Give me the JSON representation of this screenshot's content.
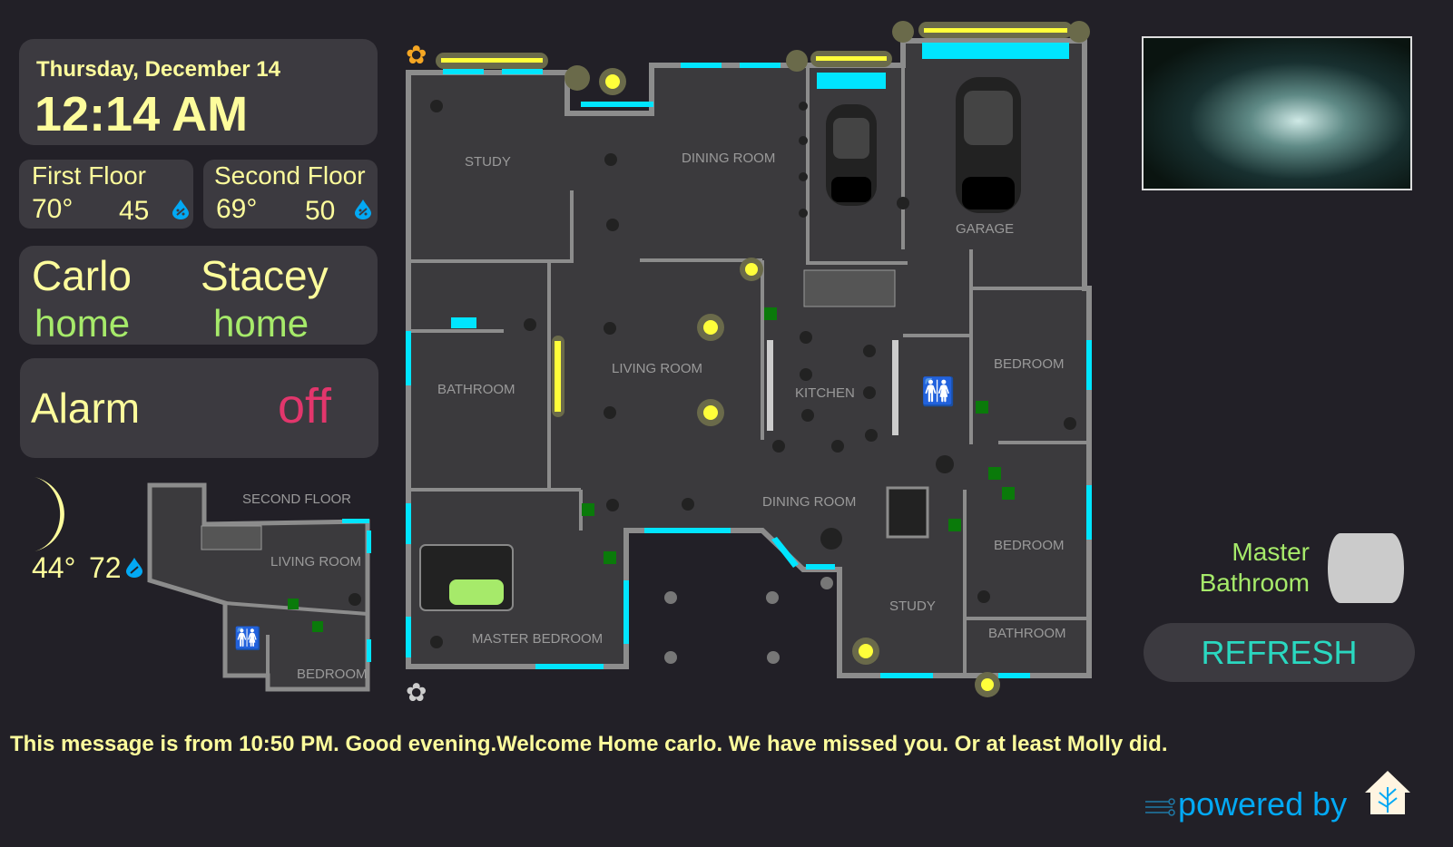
{
  "clock": {
    "date": "Thursday, December 14",
    "time": "12:14 AM"
  },
  "climate": [
    {
      "label": "First Floor",
      "temp": "70°",
      "humidity": "45",
      "icon": "humidity-drop-icon"
    },
    {
      "label": "Second Floor",
      "temp": "69°",
      "humidity": "50",
      "icon": "humidity-drop-icon"
    }
  ],
  "people": [
    {
      "name": "Carlo",
      "state": "home"
    },
    {
      "name": "Stacey",
      "state": "home"
    }
  ],
  "alarm": {
    "label": "Alarm",
    "state": "off"
  },
  "weather": {
    "icon": "moon-crescent-icon",
    "temp": "44°",
    "humidity": "72"
  },
  "second_floor": {
    "title": "SECOND FLOOR",
    "rooms": [
      "LIVING ROOM",
      "BEDROOM"
    ]
  },
  "first_floor": {
    "rooms": [
      "STUDY",
      "DINING ROOM",
      "GARAGE",
      "BATHROOM",
      "LIVING ROOM",
      "KITCHEN",
      "BEDROOM",
      "DINING ROOM",
      "BEDROOM",
      "STUDY",
      "BATHROOM",
      "MASTER BEDROOM"
    ]
  },
  "light_switch": {
    "label_line1": "Master",
    "label_line2": "Bathroom"
  },
  "refresh": {
    "label": "REFRESH"
  },
  "message": "This message is from 10:50 PM. Good evening.Welcome Home carlo. We have missed you. Or at least Molly did.",
  "footer": {
    "powered_by": "powered by",
    "logo": "home-assistant-logo"
  },
  "colors": {
    "background": "#222027",
    "card": "#3c3a40",
    "text": "#fdfc9c",
    "home": "#a6ea6a",
    "alarm_off": "#e2366c",
    "accent": "#00e5ff",
    "refresh": "#2ad8c0",
    "powered": "#03a9f4"
  }
}
